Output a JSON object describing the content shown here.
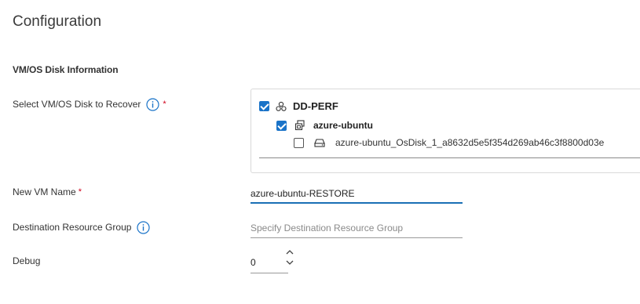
{
  "page": {
    "title": "Configuration"
  },
  "section": {
    "title": "VM/OS Disk Information"
  },
  "fields": {
    "select_disk": {
      "label": "Select VM/OS Disk to Recover",
      "required": "*"
    },
    "new_vm_name": {
      "label": "New VM Name",
      "required": "*",
      "value": "azure-ubuntu-RESTORE"
    },
    "destination_rg": {
      "label": "Destination Resource Group",
      "placeholder": "Specify Destination Resource Group",
      "value": ""
    },
    "debug": {
      "label": "Debug",
      "value": "0"
    }
  },
  "tree": {
    "root": {
      "label": "DD-PERF",
      "checked": true,
      "icon": "cluster-icon"
    },
    "vm": {
      "label": "azure-ubuntu",
      "checked": true,
      "icon": "vm-icon"
    },
    "disk": {
      "label": "azure-ubuntu_OsDisk_1_a8632d5e5f354d269ab46c3f8800d03e",
      "checked": false,
      "icon": "disk-icon"
    }
  },
  "colors": {
    "accent": "#1a73c8",
    "required": "#d0021b",
    "underline_active": "#1a6fb5"
  }
}
